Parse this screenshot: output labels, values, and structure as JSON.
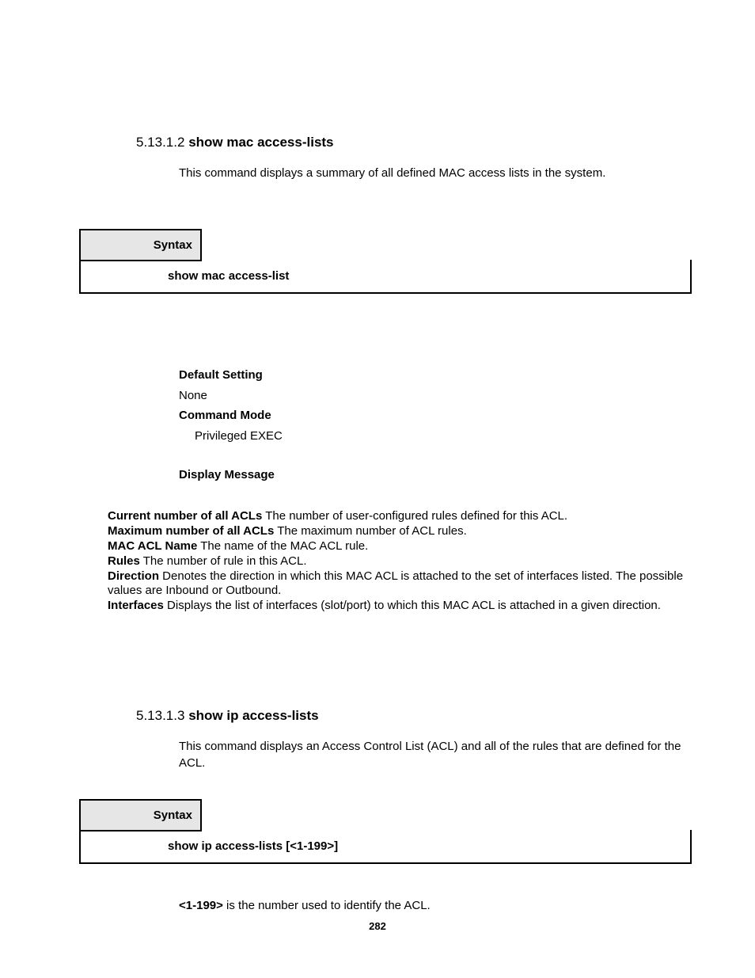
{
  "section1": {
    "number": "5.13.1.2",
    "title": "show mac access-lists",
    "description": "This command displays a summary of all defined MAC access lists in the system.",
    "syntax_label": "Syntax",
    "syntax_body": "show mac access-list",
    "default_setting_label": "Default Setting",
    "default_setting_value": "None",
    "command_mode_label": "Command Mode",
    "command_mode_value": "Privileged EXEC",
    "display_message_label": "Display Message",
    "display_items": [
      {
        "label": "Current number of all ACLs",
        "text": " The number of user-configured rules defined for this ACL."
      },
      {
        "label": "Maximum number of all ACLs",
        "text": " The maximum number of ACL rules."
      },
      {
        "label": "MAC ACL Name",
        "text": " The name of the MAC ACL rule."
      },
      {
        "label": "Rules",
        "text": " The number of rule in this ACL."
      },
      {
        "label": "Direction",
        "text": " Denotes the direction in which this MAC ACL is attached to the set of interfaces listed. The possible values are Inbound or Outbound."
      },
      {
        "label": "Interfaces",
        "text": " Displays the list of interfaces (slot/port) to which this MAC ACL is attached in a given direction."
      }
    ]
  },
  "section2": {
    "number": "5.13.1.3",
    "title": "show ip access-lists",
    "description": "This command displays an Access Control List (ACL) and all of the rules that are defined for the ACL.",
    "syntax_label": "Syntax",
    "syntax_body": "show ip access-lists [<1-199>]",
    "param_label": "<1-199>",
    "param_text": " is the number used to identify the ACL."
  },
  "page_number": "282"
}
